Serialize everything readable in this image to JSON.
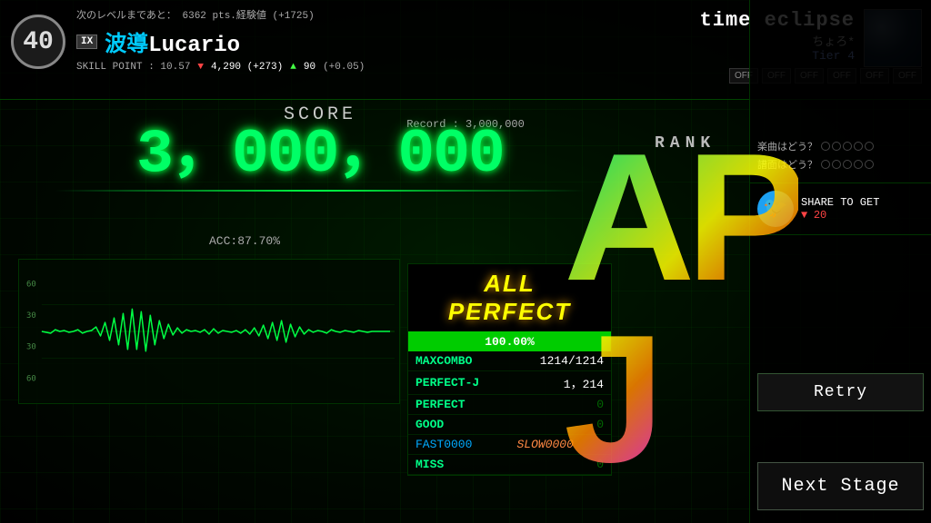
{
  "bg": {
    "color": "#000800"
  },
  "player": {
    "level": "40",
    "next_level_text": "次のレベルまであと：  6362 pts.経験値 (+1725)",
    "rank_badge": "IX",
    "name_jp": "波導",
    "name_en": "Lucario",
    "skill_label": "SKILL POINT : 10.57",
    "skill_down_arrow": "▼",
    "skill_down_value": "4,290 (+273)",
    "skill_up_arrow": "▲",
    "skill_up_value": "90",
    "skill_delta": "(+0.05)"
  },
  "song": {
    "title": "time  eclipse",
    "artist": "ちょろ*",
    "tier": "Tier 4",
    "thumbnail_alt": "song artwork"
  },
  "toggles": {
    "buttons": [
      "OFF",
      "OFF",
      "OFF",
      "OFF",
      "OFF",
      "OFF"
    ]
  },
  "score": {
    "label": "SCORE",
    "value": "3，000，000",
    "record_label": "Record : 3,000,000",
    "acc_label": "ACC:87.70%"
  },
  "rank": {
    "label": "RANK",
    "grade": "APJ"
  },
  "result": {
    "achievement": "ALL PERFECT",
    "progress_pct": "100.00%",
    "progress_fill": 100,
    "stats": [
      {
        "label": "MAXCOMBO",
        "value": "1214/1214",
        "zero": false
      },
      {
        "label": "PERFECT-J",
        "value": "1，214",
        "zero": false
      },
      {
        "label": "PERFECT",
        "value": "0",
        "zero": true
      },
      {
        "label": "GOOD",
        "value": "0",
        "zero": true
      },
      {
        "label": "MISS",
        "value": "0",
        "zero": true
      }
    ],
    "fast_label": "FAST0000",
    "slow_label": "SLOW0000"
  },
  "feedback": {
    "song_rating_label": "楽曲はどう？",
    "chart_rating_label": "譜面はどう？",
    "circles": 5
  },
  "share": {
    "title": "SHARE TO GET",
    "down_arrow": "▼",
    "count": "20",
    "twitter_icon": "🐦"
  },
  "actions": {
    "retry_label": "Retry",
    "next_stage_label": "Next Stage"
  }
}
